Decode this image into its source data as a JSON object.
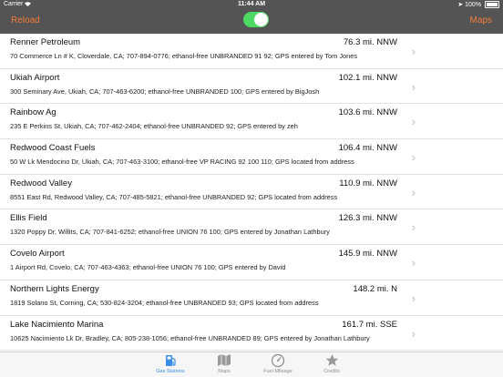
{
  "status_bar": {
    "carrier": "Carrier",
    "time": "11:44 AM",
    "battery": "100%"
  },
  "nav": {
    "left_label": "Reload",
    "right_label": "Maps",
    "toggle_on": true
  },
  "stations": [
    {
      "name": "Renner Petroleum",
      "distance": "76.3 mi. NNW",
      "detail": "70 Commerce Ln # K, Cloverdale, CA; 707-894-0776; ethanol-free UNBRANDED 91 92; GPS entered by Tom Jones"
    },
    {
      "name": "Ukiah Airport",
      "distance": "102.1 mi. NNW",
      "detail": "300 Seminary Ave, Ukiah, CA; 707-463-6200; ethanol-free UNBRANDED 100; GPS entered by BigJosh"
    },
    {
      "name": "Rainbow Ag",
      "distance": "103.6 mi. NNW",
      "detail": "235 E Perkins St, Ukiah, CA; 707-462-2404; ethanol-free UNBRANDED 92; GPS entered by zeh"
    },
    {
      "name": "Redwood Coast Fuels",
      "distance": "106.4 mi. NNW",
      "detail": "50 W Lk Mendocino Dr, Ukiah, CA; 707-463-3100; ethanol-free VP RACING 92 100 110; GPS located from address"
    },
    {
      "name": "Redwood Valley",
      "distance": "110.9 mi. NNW",
      "detail": "8551 East Rd, Redwood Valley, CA; 707-485-5821; ethanol-free UNBRANDED 92; GPS located from address"
    },
    {
      "name": "Ellis Field",
      "distance": "126.3 mi. NNW",
      "detail": "1320 Poppy Dr, Willits, CA; 707-841-6252; ethanol-free UNION 76 100; GPS entered by Jonathan Lathbury"
    },
    {
      "name": "Covelo Airport",
      "distance": "145.9 mi. NNW",
      "detail": "1 Airport Rd, Covelo, CA; 707-463-4363; ethanol-free UNION 76 100; GPS entered by David"
    },
    {
      "name": "Northern Lights Energy",
      "distance": "148.2 mi. N",
      "detail": "1819 Solano St, Corning, CA; 530-824-3204; ethanol-free UNBRANDED 93; GPS located from address"
    },
    {
      "name": "Lake Nacimiento Marina",
      "distance": "161.7 mi. SSE",
      "detail": "10625 Nacimiento Lk Dr, Bradley, CA; 805-238-1056; ethanol-free UNBRANDED 89; GPS entered by Jonathan Lathbury"
    }
  ],
  "tabs": [
    {
      "label": "Gas Stations",
      "icon": "gas-pump-icon",
      "active": true
    },
    {
      "label": "Maps",
      "icon": "map-icon",
      "active": false
    },
    {
      "label": "Fuel Mileage",
      "icon": "gauge-icon",
      "active": false
    },
    {
      "label": "Credits",
      "icon": "star-icon",
      "active": false
    }
  ],
  "colors": {
    "nav_bg": "#545454",
    "accent": "#f47b3a",
    "toggle_on": "#4cd964",
    "tab_active": "#3b8ee6"
  }
}
